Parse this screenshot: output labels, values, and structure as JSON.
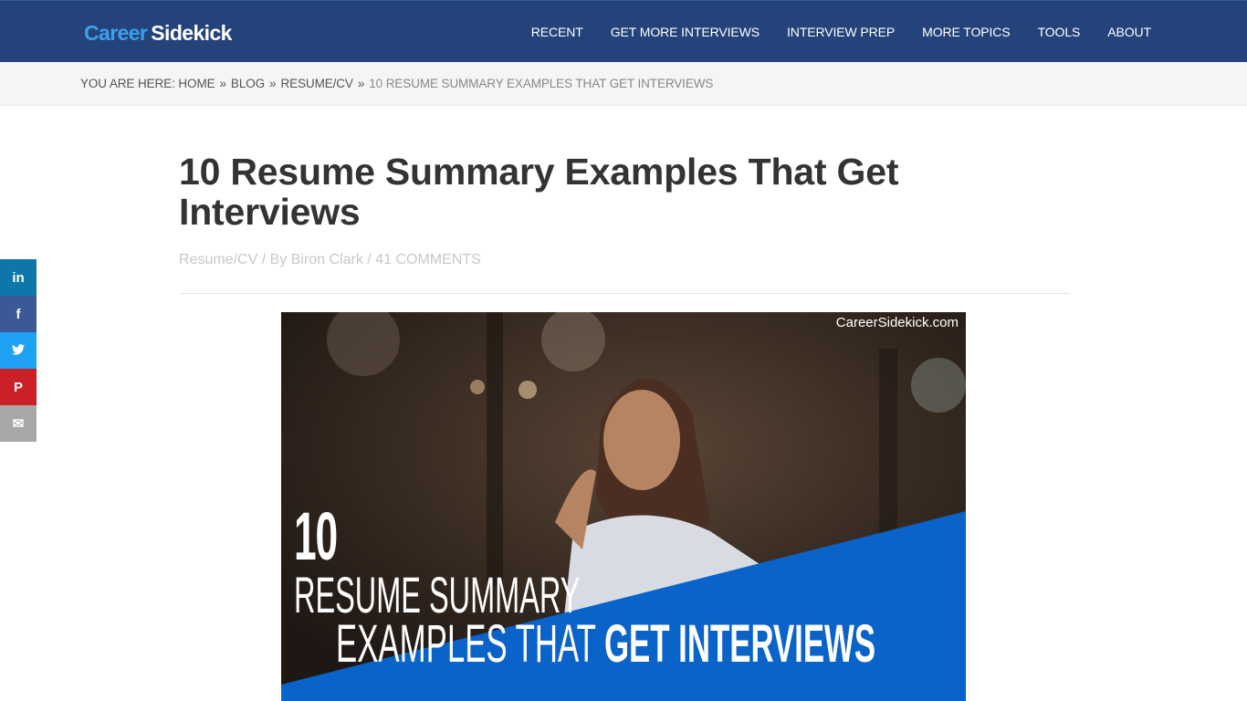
{
  "header": {
    "logo_part1": "Career",
    "logo_part2": "Sidekick",
    "nav": [
      "RECENT",
      "GET MORE INTERVIEWS",
      "INTERVIEW PREP",
      "MORE TOPICS",
      "TOOLS",
      "ABOUT"
    ]
  },
  "breadcrumb": {
    "prefix": "YOU ARE HERE:",
    "items": [
      "HOME",
      "BLOG",
      "RESUME/CV"
    ],
    "separator": "»",
    "current": "10 RESUME SUMMARY EXAMPLES THAT GET INTERVIEWS"
  },
  "article": {
    "title": "10 Resume Summary Examples That Get Interviews",
    "category": "Resume/CV",
    "byline_prefix": "By",
    "author": "Biron Clark",
    "comments": "41 COMMENTS",
    "meta_sep": "/"
  },
  "hero": {
    "watermark": "CareerSidekick.com",
    "number": "10",
    "line1": "RESUME SUMMARY",
    "line2_light": "EXAMPLES THAT",
    "line2_bold": "GET INTERVIEWS",
    "accent_color": "#0a63c9"
  },
  "share": {
    "icons": [
      "linkedin-icon",
      "facebook-icon",
      "twitter-icon",
      "pinterest-icon",
      "email-icon"
    ],
    "glyphs": [
      "in",
      "f",
      "🐦",
      "P",
      "✉"
    ]
  }
}
